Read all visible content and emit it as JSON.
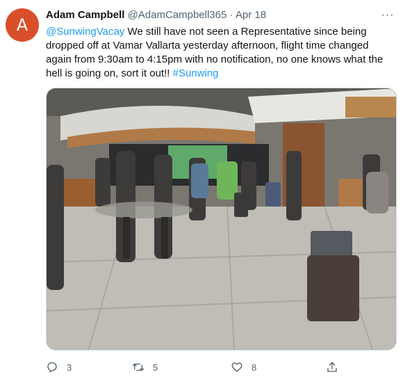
{
  "tweet": {
    "avatar_letter": "A",
    "author_name": "Adam Campbell",
    "author_handle": "@AdamCampbell365",
    "separator": "·",
    "date": "Apr 18",
    "more_label": "···",
    "mention": "@SunwingVacay",
    "body": " We still have not seen a Representative since being dropped off at Vamar Vallarta yesterday afternoon, flight time changed again from 9:30am to 4:15pm with no notification, no one knows what the hell is going on, sort it out!! ",
    "hashtag": "#Sunwing",
    "replies": "3",
    "retweets": "5",
    "likes": "8"
  },
  "colors": {
    "avatar": "#d94f2a",
    "link": "#1d9bf0",
    "muted": "#536471"
  },
  "icons": {
    "reply": "reply-icon",
    "retweet": "retweet-icon",
    "like": "heart-icon",
    "share": "share-icon",
    "more": "more-icon"
  }
}
